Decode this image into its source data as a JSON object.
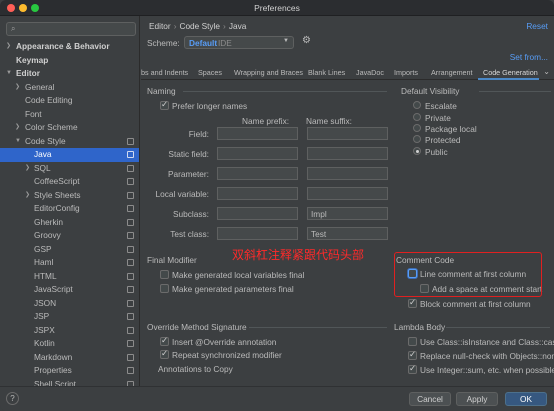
{
  "window": {
    "title": "Preferences"
  },
  "sidebar": {
    "search_placeholder": "",
    "items": [
      {
        "label": "Appearance & Behavior",
        "bold": true
      },
      {
        "label": "Keymap",
        "bold": true
      },
      {
        "label": "Editor",
        "bold": true
      },
      {
        "label": "General"
      },
      {
        "label": "Code Editing"
      },
      {
        "label": "Font"
      },
      {
        "label": "Color Scheme"
      },
      {
        "label": "Code Style"
      },
      {
        "label": "Java",
        "selected": true
      },
      {
        "label": "SQL"
      },
      {
        "label": "CoffeeScript"
      },
      {
        "label": "Style Sheets"
      },
      {
        "label": "EditorConfig"
      },
      {
        "label": "Gherkin"
      },
      {
        "label": "Groovy"
      },
      {
        "label": "GSP"
      },
      {
        "label": "Haml"
      },
      {
        "label": "HTML"
      },
      {
        "label": "JavaScript"
      },
      {
        "label": "JSON"
      },
      {
        "label": "JSP"
      },
      {
        "label": "JSPX"
      },
      {
        "label": "Kotlin"
      },
      {
        "label": "Markdown"
      },
      {
        "label": "Properties"
      },
      {
        "label": "Shell Script"
      }
    ]
  },
  "header": {
    "breadcrumb": [
      "Editor",
      "Code Style",
      "Java"
    ],
    "reset": "Reset",
    "scheme_label": "Scheme:",
    "scheme_value": "Default",
    "scheme_suffix": "IDE",
    "set_from": "Set from..."
  },
  "tabs": [
    "bs and Indents",
    "Spaces",
    "Wrapping and Braces",
    "Blank Lines",
    "JavaDoc",
    "Imports",
    "Arrangement",
    "Code Generation"
  ],
  "naming": {
    "title": "Naming",
    "prefer_longer": "Prefer longer names",
    "prefix_header": "Name prefix:",
    "suffix_header": "Name suffix:",
    "rows": [
      {
        "label": "Field:",
        "prefix": "",
        "suffix": ""
      },
      {
        "label": "Static field:",
        "prefix": "",
        "suffix": ""
      },
      {
        "label": "Parameter:",
        "prefix": "",
        "suffix": ""
      },
      {
        "label": "Local variable:",
        "prefix": "",
        "suffix": ""
      },
      {
        "label": "Subclass:",
        "prefix": "",
        "suffix": "Impl"
      },
      {
        "label": "Test class:",
        "prefix": "",
        "suffix": "Test"
      }
    ]
  },
  "default_visibility": {
    "title": "Default Visibility",
    "options": [
      "Escalate",
      "Private",
      "Package local",
      "Protected",
      "Public"
    ],
    "selected": "Public"
  },
  "final_modifier": {
    "title": "Final Modifier",
    "items": [
      "Make generated local variables final",
      "Make generated parameters final"
    ]
  },
  "annotation_text": "双斜杠注释紧跟代码头部",
  "comment_code": {
    "title": "Comment Code",
    "line_comment": "Line comment at first column",
    "add_space": "Add a space at comment start",
    "block_comment": "Block comment at first column"
  },
  "override": {
    "title": "Override Method Signature",
    "insert": "Insert @Override annotation",
    "repeat": "Repeat synchronized modifier",
    "annotations": "Annotations to Copy"
  },
  "lambda": {
    "title": "Lambda Body",
    "items": [
      "Use Class::isInstance and Class::cast",
      "Replace null-check with Objects::nonNull",
      "Use Integer::sum, etc. when possible"
    ]
  },
  "footer": {
    "help": "?",
    "cancel": "Cancel",
    "apply": "Apply",
    "ok": "OK"
  }
}
